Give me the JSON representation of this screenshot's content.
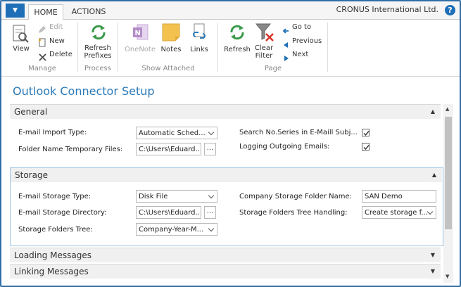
{
  "tabs": {
    "home": "HOME",
    "actions": "ACTIONS"
  },
  "company": "CRONUS International Ltd.",
  "help_glyph": "?",
  "ribbon": {
    "view": "View",
    "edit": "Edit",
    "new": "New",
    "delete": "Delete",
    "refresh_prefixes_1": "Refresh",
    "refresh_prefixes_2": "Prefixes",
    "onenote": "OneNote",
    "notes": "Notes",
    "links": "Links",
    "refresh": "Refresh",
    "clear_filter_1": "Clear",
    "clear_filter_2": "Filter",
    "goto": "Go to",
    "previous": "Previous",
    "next": "Next",
    "groups": {
      "manage": "Manage",
      "process": "Process",
      "show_attached": "Show Attached",
      "page": "Page"
    }
  },
  "page_title": "Outlook Connector Setup",
  "general": {
    "header": "General",
    "email_import_type_label": "E-mail Import Type:",
    "email_import_type_value": "Automatic Sched...",
    "folder_temp_label": "Folder Name Temporary Files:",
    "folder_temp_value": "C:\\Users\\Eduard...",
    "search_series_label": "Search No.Series in E-Maill Subj...",
    "search_series_checked": true,
    "logging_label": "Logging Outgoing Emails:",
    "logging_checked": true
  },
  "storage": {
    "header": "Storage",
    "storage_type_label": "E-mail Storage Type:",
    "storage_type_value": "Disk File",
    "storage_dir_label": "E-mail Storage Directory:",
    "storage_dir_value": "C:\\Users\\Eduard...",
    "folders_tree_label": "Storage Folders Tree:",
    "folders_tree_value": "Company-Year-M...",
    "company_folder_label": "Company Storage Folder Name:",
    "company_folder_value": "SAN Demo",
    "tree_handling_label": "Storage Folders Tree Handling:",
    "tree_handling_value": "Create storage f..."
  },
  "loading_header": "Loading Messages",
  "linking_header": "Linking Messages",
  "ellipsis": "...",
  "colors": {
    "accent": "#2a7ab8",
    "app_button": "#1e6fb8",
    "frame": "#2f6fa8",
    "checkbox_mark": "#333333"
  }
}
